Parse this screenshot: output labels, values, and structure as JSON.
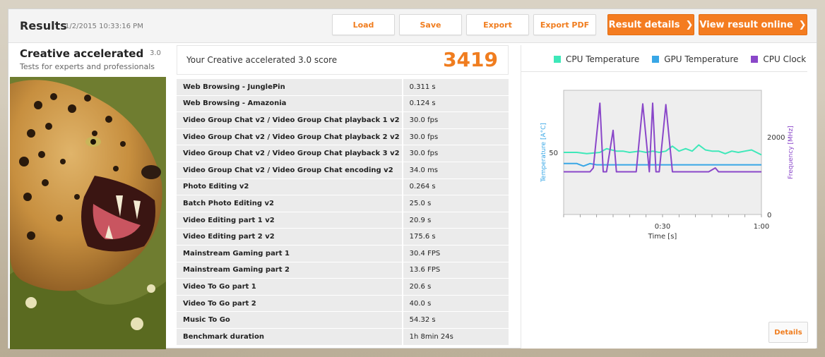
{
  "header": {
    "title": "Results",
    "timestamp": "1/2/2015 10:33:16 PM",
    "buttons": {
      "load": "Load",
      "save": "Save",
      "export": "Export",
      "export_pdf": "Export PDF",
      "result_details": "Result details",
      "view_online": "View result online"
    }
  },
  "test": {
    "name": "Creative accelerated",
    "version": "3.0",
    "description": "Tests for experts and professionals"
  },
  "score": {
    "label": "Your Creative accelerated 3.0 score",
    "value": "3419"
  },
  "results": [
    {
      "name": "Web Browsing - JunglePin",
      "value": "0.311 s"
    },
    {
      "name": "Web Browsing - Amazonia",
      "value": "0.124 s"
    },
    {
      "name": "Video Group Chat v2 / Video Group Chat playback 1 v2",
      "value": "30.0 fps"
    },
    {
      "name": "Video Group Chat v2 / Video Group Chat playback 2 v2",
      "value": "30.0 fps"
    },
    {
      "name": "Video Group Chat v2 / Video Group Chat playback 3 v2",
      "value": "30.0 fps"
    },
    {
      "name": "Video Group Chat v2 / Video Group Chat encoding v2",
      "value": "34.0 ms"
    },
    {
      "name": "Photo Editing v2",
      "value": "0.264 s"
    },
    {
      "name": "Batch Photo Editing v2",
      "value": "25.0 s"
    },
    {
      "name": "Video Editing part 1 v2",
      "value": "20.9 s"
    },
    {
      "name": "Video Editing part 2 v2",
      "value": "175.6 s"
    },
    {
      "name": "Mainstream Gaming part 1",
      "value": "30.4 FPS"
    },
    {
      "name": "Mainstream Gaming part 2",
      "value": "13.6 FPS"
    },
    {
      "name": "Video To Go part 1",
      "value": "20.6 s"
    },
    {
      "name": "Video To Go part 2",
      "value": "40.0 s"
    },
    {
      "name": "Music To Go",
      "value": "54.32 s"
    },
    {
      "name": "Benchmark duration",
      "value": "1h 8min 24s"
    }
  ],
  "monitor": {
    "details_label": "Details",
    "legend": [
      {
        "label": "CPU Temperature",
        "color": "#3ee8b9"
      },
      {
        "label": "GPU Temperature",
        "color": "#38a7e6"
      },
      {
        "label": "CPU Clock",
        "color": "#8a47c9"
      }
    ]
  },
  "chart_data": {
    "type": "line",
    "xlabel": "Time [s]",
    "ylabel_left": "Temperature [A°C]",
    "ylabel_right": "Frequency [MHz]",
    "x_ticks": [
      "0:30",
      "1:00"
    ],
    "y_left_ticks": [
      "50"
    ],
    "y_right_ticks": [
      "2000",
      "0"
    ],
    "xlim": [
      0,
      60
    ],
    "ylim_left": [
      0,
      100
    ],
    "ylim_right": [
      0,
      3200
    ],
    "series": [
      {
        "name": "CPU Temperature",
        "axis": "left",
        "color": "#3ee8b9",
        "x": [
          0,
          4,
          7,
          11,
          13,
          16,
          18,
          20,
          23,
          25,
          27,
          29,
          31,
          33,
          35,
          37,
          39,
          41,
          43,
          45,
          47,
          49,
          51,
          53,
          55,
          57,
          60
        ],
        "y": [
          50,
          50,
          49,
          50,
          53,
          51,
          51,
          50,
          51,
          50,
          51,
          50,
          51,
          55,
          51,
          53,
          51,
          56,
          52,
          51,
          51,
          49,
          51,
          50,
          51,
          52,
          48
        ]
      },
      {
        "name": "GPU Temperature",
        "axis": "left",
        "color": "#38a7e6",
        "x": [
          0,
          4,
          6,
          8,
          10,
          60
        ],
        "y": [
          41,
          41,
          39,
          41,
          40,
          40
        ]
      },
      {
        "name": "CPU Clock",
        "axis": "right",
        "color": "#8a47c9",
        "x": [
          0,
          8,
          9,
          11,
          12,
          13,
          15,
          16,
          17,
          22,
          24,
          26,
          27,
          28,
          29,
          31,
          33,
          34,
          35,
          36,
          44,
          46,
          47,
          60
        ],
        "y": [
          1100,
          1100,
          1200,
          2870,
          1100,
          1100,
          2170,
          1100,
          1100,
          1100,
          2850,
          1100,
          2870,
          1100,
          1100,
          2830,
          1100,
          1100,
          1100,
          1100,
          1100,
          1200,
          1100,
          1100
        ]
      }
    ]
  }
}
